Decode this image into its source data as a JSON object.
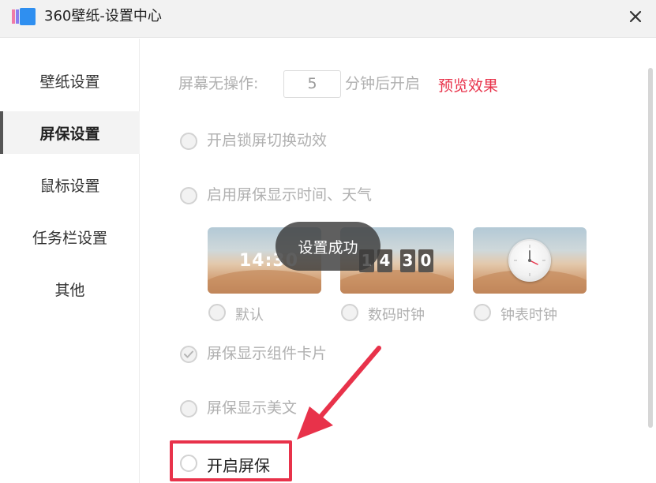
{
  "window": {
    "title": "360壁纸-设置中心",
    "close_icon": "close-icon",
    "logo_icon": "app-logo-icon"
  },
  "sidebar": {
    "items": [
      {
        "label": "壁纸设置",
        "active": false
      },
      {
        "label": "屏保设置",
        "active": true
      },
      {
        "label": "鼠标设置",
        "active": false
      },
      {
        "label": "任务栏设置",
        "active": false
      },
      {
        "label": "其他",
        "active": false
      }
    ]
  },
  "screensaver": {
    "idle_prefix": "屏幕无操作:",
    "idle_minutes": "5",
    "idle_suffix": "分钟后开启",
    "preview_link": "预览效果",
    "lockscreen_transition": {
      "label": "开启锁屏切换动效",
      "checked": false
    },
    "show_time_weather": {
      "label": "启用屏保显示时间、天气",
      "checked": false
    },
    "clock_styles": [
      {
        "label": "默认",
        "preview_text": "14:30",
        "checked": false
      },
      {
        "label": "数码时钟",
        "digits": [
          "1",
          "4",
          "3",
          "0"
        ],
        "checked": false
      },
      {
        "label": "钟表时钟",
        "icon": "analog-clock-icon",
        "checked": false
      }
    ],
    "show_widget_cards": {
      "label": "屏保显示组件卡片",
      "checked": true
    },
    "show_quotes": {
      "label": "屏保显示美文",
      "checked": false
    },
    "enable_screensaver": {
      "label": "开启屏保",
      "checked": false
    }
  },
  "toast": {
    "text": "设置成功"
  },
  "colors": {
    "accent_red": "#e8324a",
    "disabled_text": "#b0b0b0",
    "active_sidebar_bg": "#f3f3f3"
  }
}
